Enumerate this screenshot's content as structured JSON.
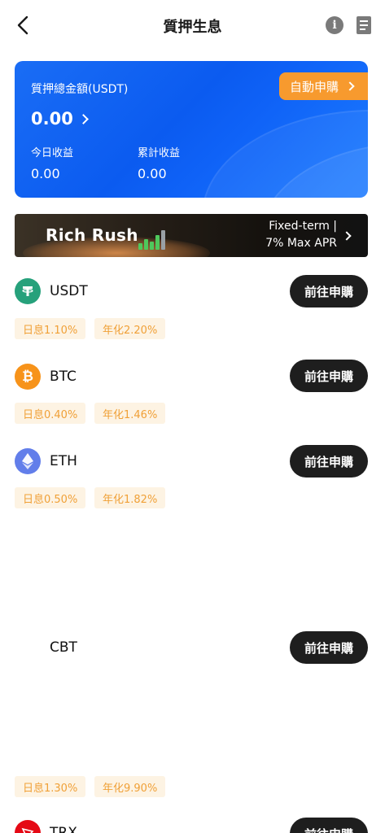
{
  "header": {
    "title": "質押生息",
    "back_icon": "chevron-left-icon",
    "info_icon": "info-icon",
    "doc_icon": "document-icon"
  },
  "summary": {
    "total_label": "質押總金額(USDT)",
    "total_value": "0.00",
    "auto_subscribe": "自動申購",
    "today_label": "今日收益",
    "today_value": "0.00",
    "cumulative_label": "累計收益",
    "cumulative_value": "0.00"
  },
  "banner": {
    "title": "Rich Rush",
    "line1": "Fixed-term |",
    "line2": "7% Max APR"
  },
  "coins": [
    {
      "name": "USDT",
      "button": "前往申購",
      "daily": "日息1.10%",
      "annual": "年化2.20%",
      "icon_color": "#26a17b"
    },
    {
      "name": "BTC",
      "button": "前往申購",
      "daily": "日息0.40%",
      "annual": "年化1.46%",
      "icon_color": "#f7931a"
    },
    {
      "name": "ETH",
      "button": "前往申購",
      "daily": "日息0.50%",
      "annual": "年化1.82%",
      "icon_color": "#627eea"
    },
    {
      "name": "CBT",
      "button": "前往申購",
      "daily": "日息1.30%",
      "annual": "年化9.90%",
      "icon_color": ""
    },
    {
      "name": "TRX",
      "button": "前往申購",
      "icon_color": "#e50915"
    }
  ],
  "colors": {
    "accent_orange": "#f79a2e",
    "card_blue": "#0b5bf0",
    "tag_text": "#f0a037",
    "tag_bg": "#fdf3e3",
    "button_dark": "#1e1e1e"
  }
}
